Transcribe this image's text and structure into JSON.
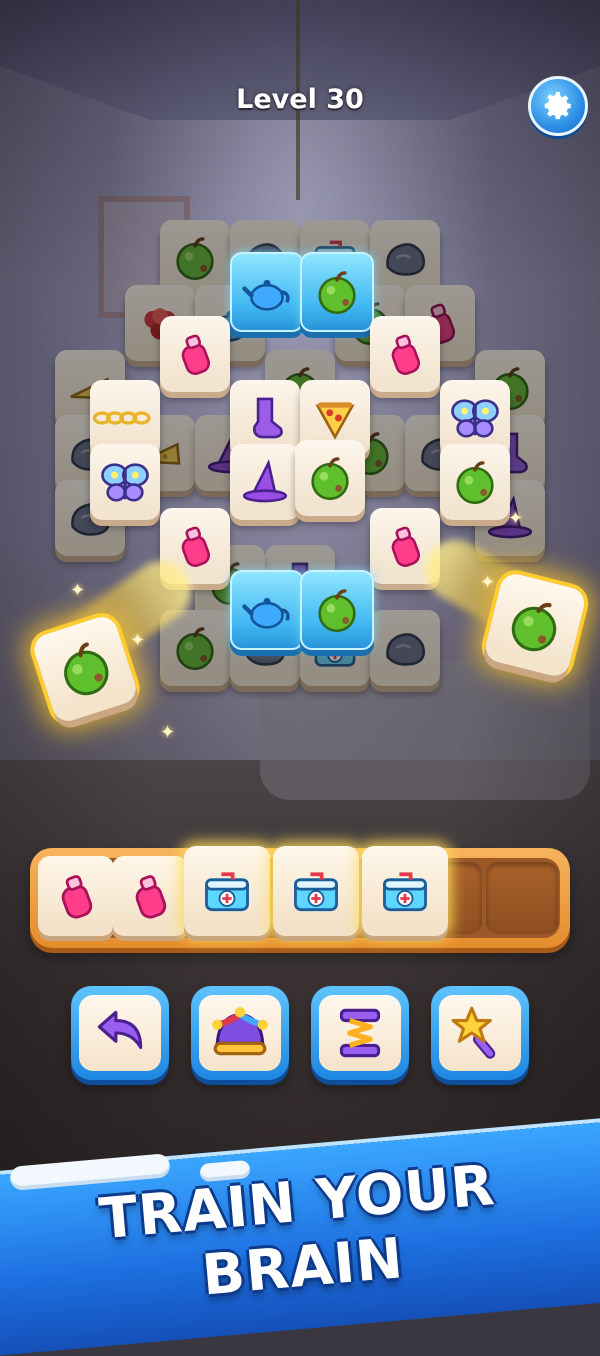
{
  "header": {
    "level_label": "Level 30",
    "settings_icon": "gear-icon"
  },
  "board": {
    "tile_types": [
      "apple",
      "bottle",
      "teapot",
      "first-aid-kit",
      "rock",
      "sock",
      "pizza",
      "butterfly",
      "witch-hat",
      "flower",
      "cheese",
      "chain"
    ],
    "frozen_tiles": 4,
    "flying_tiles": [
      "apple",
      "apple"
    ]
  },
  "tray": {
    "capacity": 7,
    "items": [
      "bottle",
      "bottle",
      "first-aid-kit",
      "first-aid-kit",
      "first-aid-kit"
    ]
  },
  "boosters": [
    {
      "name": "undo",
      "icon": "undo-arrow-icon"
    },
    {
      "name": "shuffle",
      "icon": "jester-hat-icon"
    },
    {
      "name": "magnet",
      "icon": "spring-icon"
    },
    {
      "name": "magic",
      "icon": "magic-wand-icon"
    }
  ],
  "banner": {
    "text": "TRAIN YOUR BRAIN"
  },
  "colors": {
    "accent_blue": "#1d86e0",
    "tray_orange": "#e48c2c",
    "glow_yellow": "#ffd23a",
    "banner_blue": "#1d6fe0"
  }
}
